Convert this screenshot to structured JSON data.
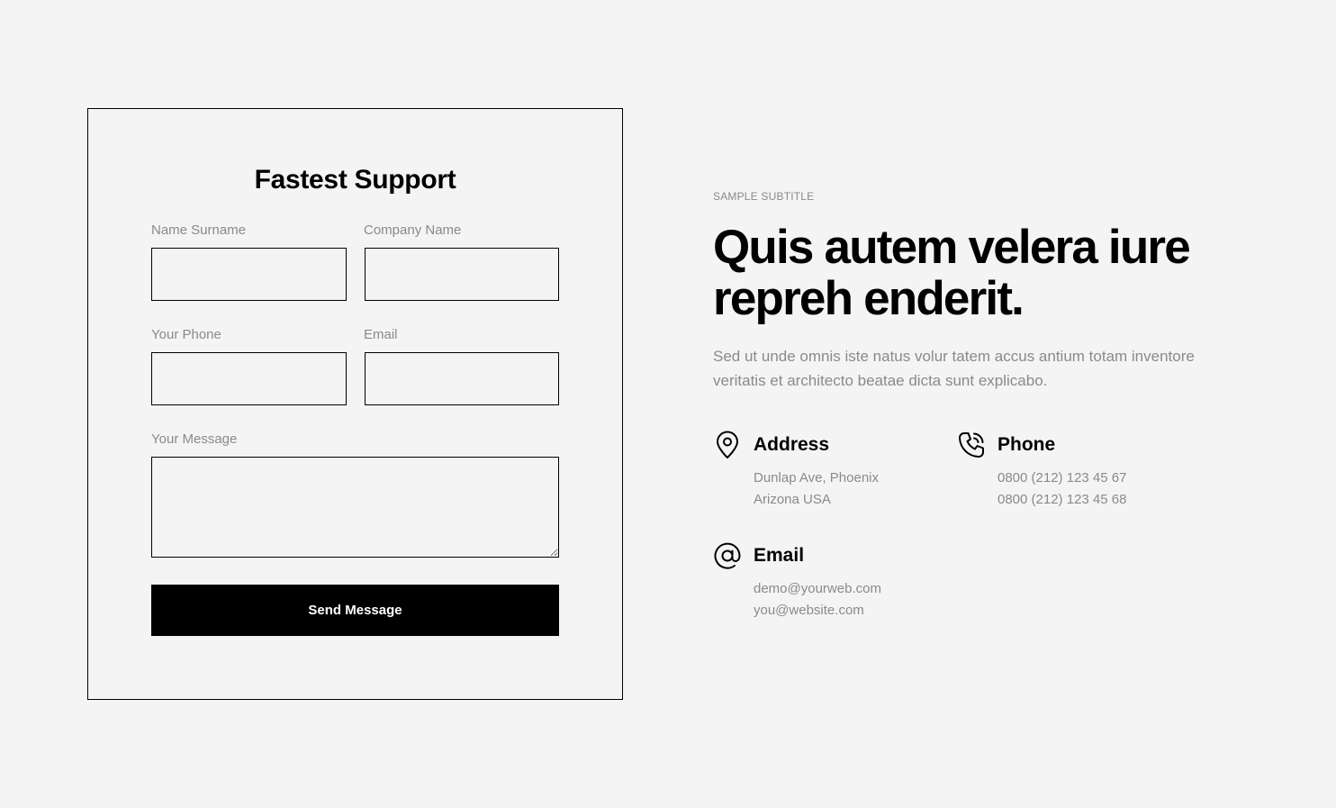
{
  "form": {
    "title": "Fastest Support",
    "fields": {
      "name_label": "Name Surname",
      "company_label": "Company Name",
      "phone_label": "Your Phone",
      "email_label": "Email",
      "message_label": "Your Message",
      "name_value": "",
      "company_value": "",
      "phone_value": "",
      "email_value": "",
      "message_value": ""
    },
    "submit_label": "Send Message"
  },
  "info": {
    "subtitle": "SAMPLE SUBTITLE",
    "headline": "Quis autem velera iure repreh enderit.",
    "lead": "Sed ut unde omnis iste natus volur tatem accus antium totam inventore veritatis et architecto beatae dicta sunt explicabo.",
    "contacts": {
      "address": {
        "icon": "map-pin-icon",
        "title": "Address",
        "lines": [
          "Dunlap Ave, Phoenix",
          "Arizona USA"
        ]
      },
      "phone": {
        "icon": "phone-icon",
        "title": "Phone",
        "lines": [
          "0800 (212) 123 45 67",
          "0800 (212) 123 45 68"
        ]
      },
      "email": {
        "icon": "at-sign-icon",
        "title": "Email",
        "lines": [
          "demo@yourweb.com",
          "you@website.com"
        ]
      }
    }
  },
  "colors": {
    "background": "#f4f4f4",
    "text": "#000000",
    "muted": "#8a8a8a",
    "button_bg": "#000000",
    "button_text": "#ffffff"
  }
}
